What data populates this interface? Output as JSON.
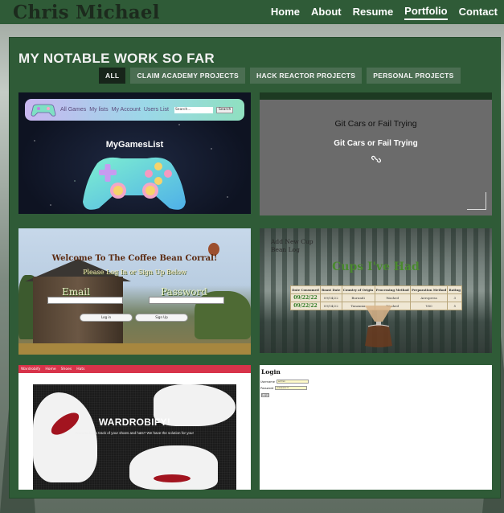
{
  "header": {
    "brand": "Chris Michael",
    "nav": [
      "Home",
      "About",
      "Resume",
      "Portfolio",
      "Contact"
    ],
    "active": "Portfolio"
  },
  "section": {
    "title": "MY NOTABLE WORK SO FAR",
    "filters": [
      "ALL",
      "CLAIM ACADEMY PROJECTS",
      "HACK REACTOR PROJECTS",
      "PERSONAL PROJECTS"
    ],
    "active_filter": "ALL"
  },
  "projects": [
    {
      "name": "MyGamesList",
      "nav": [
        "All Games",
        "My lists",
        "My Account",
        "Users List"
      ],
      "search_placeholder": "Search...",
      "search_button": "Search"
    },
    {
      "name": "Git Cars or Fail Trying",
      "overlay": "Git Cars or Fail Trying",
      "icon": "link-icon"
    },
    {
      "name": "Welcome To The Coffee Bean Corral!",
      "subtitle": "Please Log In or Sign Up Below",
      "email_label": "Email",
      "password_label": "Password",
      "login": "Log in",
      "signup": "Sign Up"
    },
    {
      "links": [
        "Add New Cup",
        "Bean Log"
      ],
      "name": "Cups I've Had",
      "columns": [
        "Date Consumed",
        "Roast Date",
        "Country of Origin",
        "Processing Method",
        "Preparation Method",
        "Rating"
      ],
      "rows": [
        [
          "09/22/22",
          "09/14/22",
          "Burundi",
          "Washed",
          "Aeropress",
          "3"
        ],
        [
          "09/22/22",
          "09/14/22",
          "Tanzania",
          "Washed",
          "V60",
          "5"
        ]
      ]
    },
    {
      "brand": "Wardrobify",
      "nav": [
        "Home",
        "Shoes",
        "Hats"
      ],
      "name": "WARDROBIFY!",
      "tagline": "Need to keep track of your shoes and hats? We have the solution for you!"
    },
    {
      "name": "Login",
      "username_label": "Username",
      "username_value": "admin",
      "password_label": "Password",
      "password_value": "password",
      "button": "Login"
    }
  ],
  "colors": {
    "nav_bg": "#2f5b37",
    "panel_bg": "#2f5b37",
    "filter_active": "#17251a",
    "filter_default": "#4b6e52"
  }
}
